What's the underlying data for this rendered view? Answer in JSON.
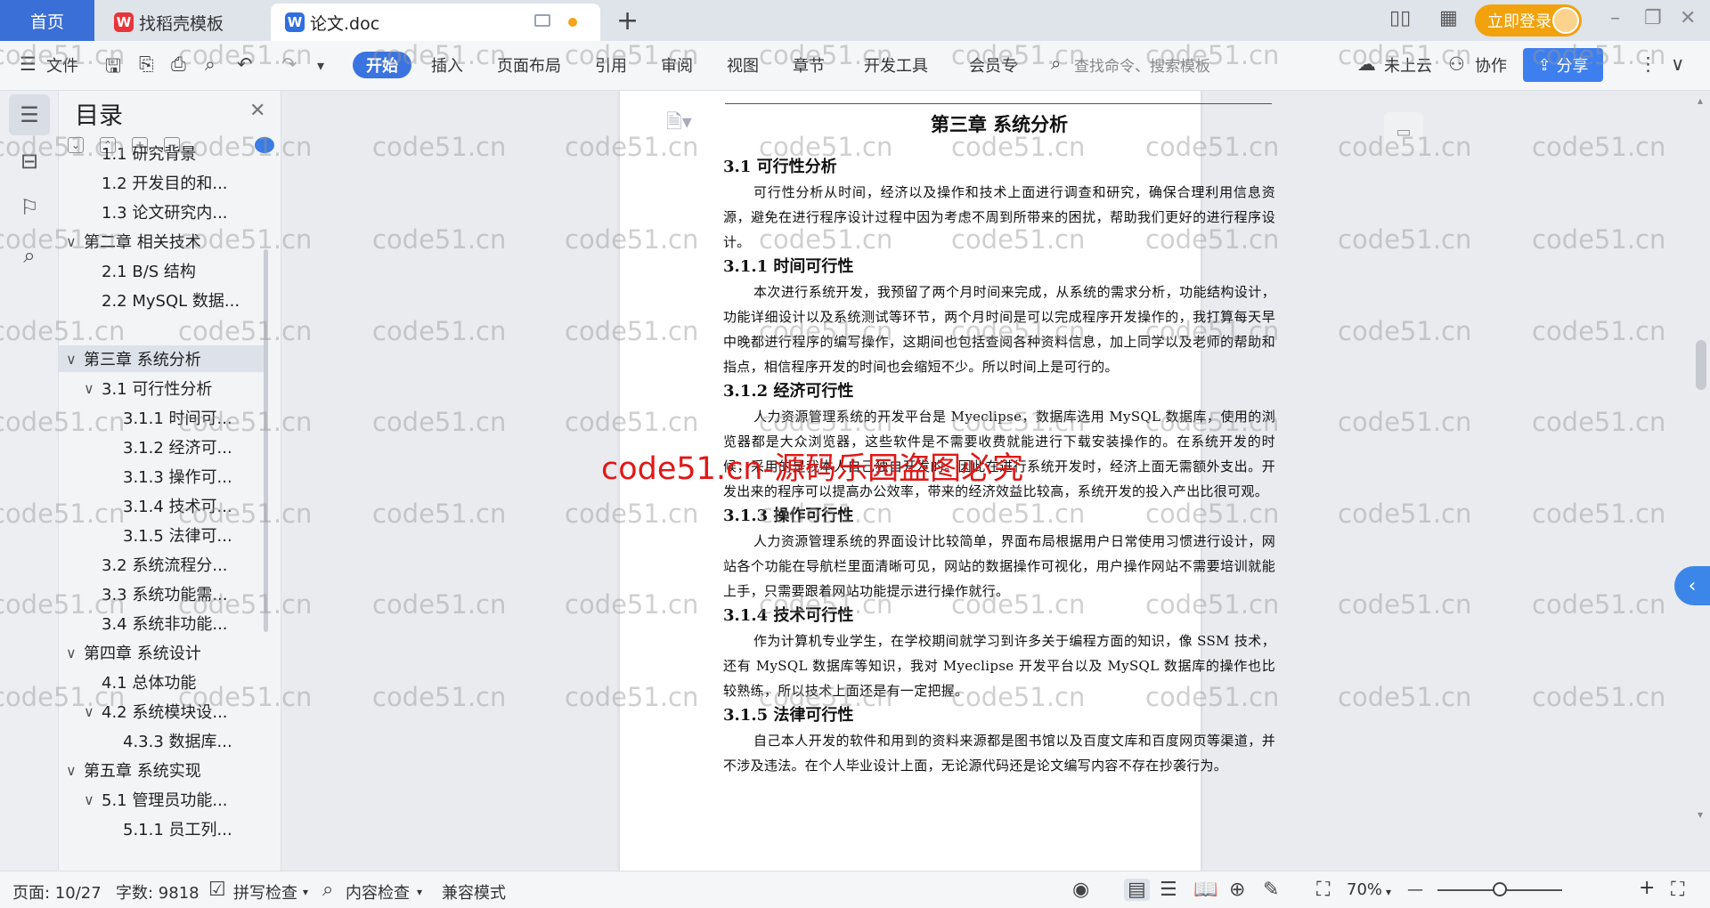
{
  "tabs": {
    "home": "首页",
    "templates": "找稻壳模板",
    "doc": "论文.doc",
    "add": "+"
  },
  "topbar": {
    "login": "立即登录",
    "minimize": "–",
    "restore": "❐",
    "close": "✕"
  },
  "ribbon": {
    "file_menu": "文件",
    "tabs": [
      "开始",
      "插入",
      "页面布局",
      "引用",
      "审阅",
      "视图",
      "章节",
      "开发工具",
      "会员专"
    ],
    "search_placeholder": "查找命令、搜索模板",
    "cloud": "未上云",
    "collab": "协作",
    "share": "分享",
    "more": "⋮",
    "expand": "∨"
  },
  "toc": {
    "title": "目录",
    "items": [
      {
        "label": "1.1 研究背景",
        "level": 2
      },
      {
        "label": "1.2 开发目的和...",
        "level": 2
      },
      {
        "label": "1.3 论文研究内...",
        "level": 2
      },
      {
        "label": "第二章 相关技术",
        "level": 1,
        "arrow": "∨"
      },
      {
        "label": "2.1 B/S 结构",
        "level": 2
      },
      {
        "label": "2.2 MySQL 数据...",
        "level": 2
      },
      {
        "label": "",
        "level": 2
      },
      {
        "label": "第三章 系统分析",
        "level": 1,
        "arrow": "∨",
        "active": true
      },
      {
        "label": "3.1 可行性分析",
        "level": 2,
        "arrow": "∨"
      },
      {
        "label": "3.1.1 时间可...",
        "level": 3
      },
      {
        "label": "3.1.2 经济可...",
        "level": 3
      },
      {
        "label": "3.1.3 操作可...",
        "level": 3
      },
      {
        "label": "3.1.4 技术可...",
        "level": 3
      },
      {
        "label": "3.1.5 法律可...",
        "level": 3
      },
      {
        "label": "3.2 系统流程分...",
        "level": 2
      },
      {
        "label": "3.3 系统功能需...",
        "level": 2
      },
      {
        "label": "3.4 系统非功能...",
        "level": 2
      },
      {
        "label": "第四章 系统设计",
        "level": 1,
        "arrow": "∨"
      },
      {
        "label": "4.1 总体功能",
        "level": 2
      },
      {
        "label": "4.2 系统模块设...",
        "level": 2,
        "arrow": "∨"
      },
      {
        "label": "4.3.3 数据库...",
        "level": 3
      },
      {
        "label": "第五章 系统实现",
        "level": 1,
        "arrow": "∨"
      },
      {
        "label": "5.1 管理员功能...",
        "level": 2,
        "arrow": "∨"
      },
      {
        "label": "5.1.1 员工列...",
        "level": 3
      }
    ]
  },
  "document": {
    "chapter": "第三章 系统分析",
    "sections": [
      {
        "heading": "3.1 可行性分析",
        "type": "h2",
        "text": "可行性分析从时间，经济以及操作和技术上面进行调查和研究，确保合理利用信息资源，避免在进行程序设计过程中因为考虑不周到所带来的困扰，帮助我们更好的进行程序设计。"
      },
      {
        "heading": "3.1.1 时间可行性",
        "type": "h3",
        "text": "本次进行系统开发，我预留了两个月时间来完成，从系统的需求分析，功能结构设计，功能详细设计以及系统测试等环节，两个月时间是可以完成程序开发操作的，我打算每天早中晚都进行程序的编写操作，这期间也包括查阅各种资料信息，加上同学以及老师的帮助和指点，相信程序开发的时间也会缩短不少。所以时间上是可行的。"
      },
      {
        "heading": "3.1.2 经济可行性",
        "type": "h3",
        "text": "人力资源管理系统的开发平台是 Myeclipse，数据库选用 MySQL 数据库，使用的浏览器都是大众浏览器，这些软件是不需要收费就能进行下载安装操作的。在系统开发的时候，采用的是我本人自己独自开发的。因此在进行系统开发时，经济上面无需额外支出。开发出来的程序可以提高办公效率，带来的经济效益比较高，系统开发的投入产出比很可观。"
      },
      {
        "heading": "3.1.3 操作可行性",
        "type": "h3",
        "text": "人力资源管理系统的界面设计比较简单，界面布局根据用户日常使用习惯进行设计，网站各个功能在导航栏里面清晰可见，网站的数据操作可视化，用户操作网站不需要培训就能上手，只需要跟着网站功能提示进行操作就行。"
      },
      {
        "heading": "3.1.4 技术可行性",
        "type": "h3",
        "text": "作为计算机专业学生，在学校期间就学习到许多关于编程方面的知识，像 SSM 技术，还有 MySQL 数据库等知识，我对 Myeclipse 开发平台以及 MySQL 数据库的操作也比较熟练，所以技术上面还是有一定把握。"
      },
      {
        "heading": "3.1.5 法律可行性",
        "type": "h3",
        "text": "自己本人开发的软件和用到的资料来源都是图书馆以及百度文库和百度网页等渠道，并不涉及违法。在个人毕业设计上面，无论源代码还是论文编写内容不存在抄袭行为。"
      }
    ]
  },
  "watermark": {
    "text": "code51.cn",
    "red_text": "code51.cn-源码乐园盗图必究"
  },
  "status": {
    "page": "页面: 10/27",
    "words": "字数: 9818",
    "spell": "拼写检查",
    "content_check": "内容检查",
    "compat": "兼容模式",
    "zoom": "70%",
    "zoom_out": "—",
    "zoom_in": "+"
  }
}
